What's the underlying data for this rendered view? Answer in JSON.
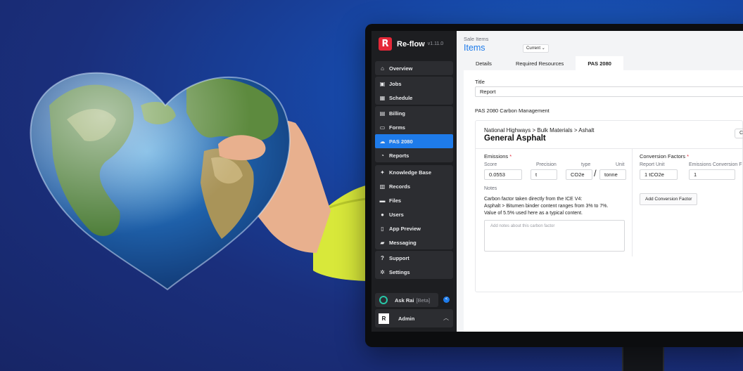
{
  "app": {
    "name": "Re-flow",
    "version": "v1.11.0",
    "logo_letter": "R",
    "brand_color": "#e52838",
    "accent_color": "#1e7bea"
  },
  "sidebar": {
    "groups": [
      [
        {
          "label": "Overview",
          "icon": "home-icon"
        }
      ],
      [
        {
          "label": "Jobs",
          "icon": "briefcase-icon"
        },
        {
          "label": "Schedule",
          "icon": "calendar-icon"
        }
      ],
      [
        {
          "label": "Billing",
          "icon": "receipt-icon"
        },
        {
          "label": "Forms",
          "icon": "document-icon"
        },
        {
          "label": "PAS 2080",
          "icon": "cloud-icon",
          "active": true
        },
        {
          "label": "Reports",
          "icon": "pie-chart-icon"
        }
      ],
      [
        {
          "label": "Knowledge Base",
          "icon": "lightbulb-icon"
        },
        {
          "label": "Records",
          "icon": "archive-icon"
        },
        {
          "label": "Files",
          "icon": "folder-icon"
        },
        {
          "label": "Users",
          "icon": "user-icon"
        },
        {
          "label": "App Preview",
          "icon": "mobile-icon"
        },
        {
          "label": "Messaging",
          "icon": "chat-icon"
        }
      ],
      [
        {
          "label": "Support",
          "icon": "help-icon"
        },
        {
          "label": "Settings",
          "icon": "gear-icon"
        }
      ]
    ],
    "ask": {
      "label": "Ask Rai",
      "badge": "[Beta]"
    },
    "admin": {
      "avatar": "R",
      "label": "Admin"
    }
  },
  "header": {
    "breadcrumb": "Sale Items",
    "title": "Items",
    "version_select": "Current"
  },
  "tabs": [
    {
      "label": "Details"
    },
    {
      "label": "Required Resources"
    },
    {
      "label": "PAS 2080",
      "active": true
    }
  ],
  "form": {
    "title_label": "Title",
    "title_value": "Report",
    "section_label": "PAS 2080 Carbon Management"
  },
  "carbon_card": {
    "path": "National Highways > Bulk Materials > Ashalt",
    "name": "General Asphalt",
    "emissions": {
      "heading": "Emissions",
      "required_mark": "*",
      "columns": {
        "score": "Score",
        "precision": "Precision",
        "type": "type",
        "unit": "Unit"
      },
      "values": {
        "score": "0.0553",
        "precision": "t",
        "type": "CO2e",
        "unit": "tonne"
      },
      "separator": "/"
    },
    "notes": {
      "label": "Notes",
      "text_line1": "Carbon factor taken directly from the ICE V4:",
      "text_line2": "Asphalt > Bitumen binder content ranges from 3% to 7%.",
      "text_line3": "Value of 5.5% used here as a typical content.",
      "placeholder": "Add notes about this carbon factor"
    },
    "conversion": {
      "heading": "Conversion Factors",
      "required_mark": "*",
      "col_report_unit": "Report Unit",
      "col_emissions": "Emissions Conversion F",
      "report_unit_value": "1 tCO2e",
      "emissions_value": "1",
      "add_button": "Add Conversion Factor"
    }
  }
}
